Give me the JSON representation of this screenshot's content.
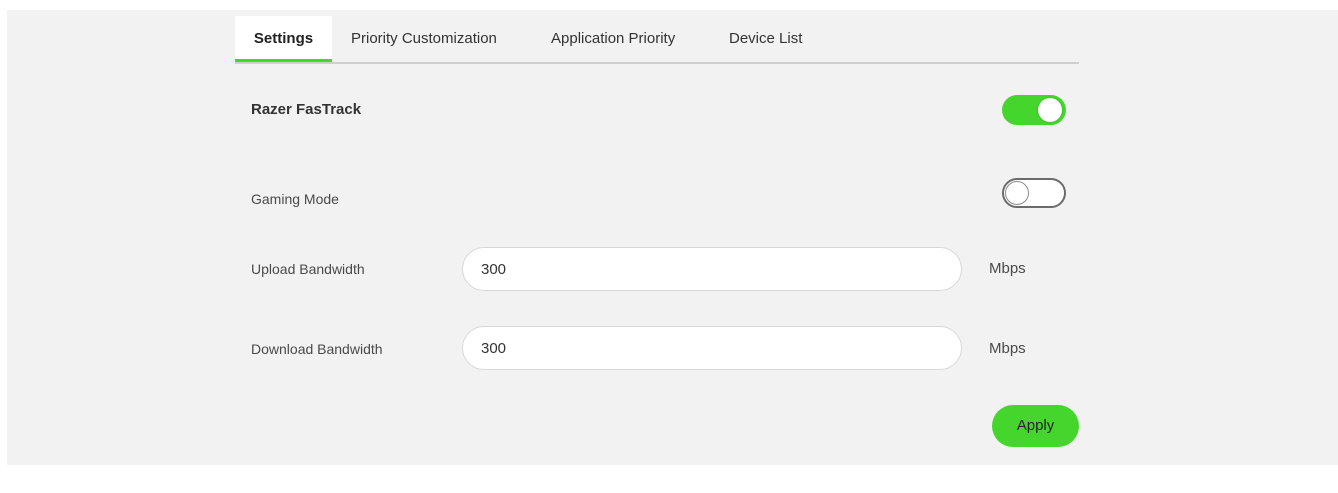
{
  "tabs": [
    {
      "label": "Settings",
      "active": true
    },
    {
      "label": "Priority Customization",
      "active": false
    },
    {
      "label": "Application Priority",
      "active": false
    },
    {
      "label": "Device List",
      "active": false
    }
  ],
  "fastrack": {
    "label": "Razer FasTrack",
    "enabled": true
  },
  "gaming_mode": {
    "label": "Gaming Mode",
    "enabled": false
  },
  "upload": {
    "label": "Upload Bandwidth",
    "value": "300",
    "unit": "Mbps"
  },
  "download": {
    "label": "Download Bandwidth",
    "value": "300",
    "unit": "Mbps"
  },
  "apply_label": "Apply",
  "colors": {
    "accent": "#44d62c",
    "panel_background": "#f2f2f2"
  }
}
